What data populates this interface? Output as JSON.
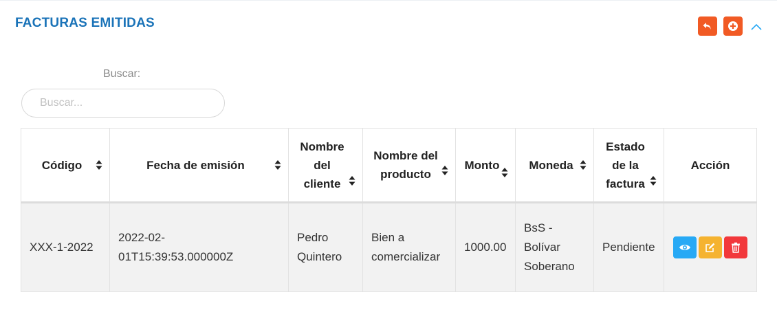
{
  "card": {
    "title": "FACTURAS EMITIDAS",
    "toolbar": [
      {
        "icon": "reply-icon",
        "color": "#f15a24"
      },
      {
        "icon": "plus-circle-icon",
        "color": "#f15a24"
      },
      {
        "icon": "chevron-up-icon",
        "color": "#27a9f5"
      }
    ]
  },
  "search": {
    "label": "Buscar:",
    "placeholder": "Buscar...",
    "value": ""
  },
  "table": {
    "columns": [
      {
        "label": "Código",
        "sortable": true
      },
      {
        "label": "Fecha de emisión",
        "sortable": true
      },
      {
        "label": "Nombre del cliente",
        "sortable": true
      },
      {
        "label": "Nombre del producto",
        "sortable": true
      },
      {
        "label": "Monto",
        "sortable": true
      },
      {
        "label": "Moneda",
        "sortable": true
      },
      {
        "label": "Estado de la factura",
        "sortable": true
      },
      {
        "label": "Acción",
        "sortable": false
      }
    ],
    "rows": [
      {
        "codigo": "XXX-1-2022",
        "fecha": "2022-02-01T15:39:53.000000Z",
        "cliente": "Pedro Quintero",
        "producto": "Bien a comercializar",
        "monto": "1000.00",
        "moneda": "BsS - Bolívar Soberano",
        "estado": "Pendiente",
        "actions": [
          {
            "icon": "eye-icon",
            "color": "#27a9f5"
          },
          {
            "icon": "edit-icon",
            "color": "#f5b330"
          },
          {
            "icon": "trash-icon",
            "color": "#f2383b"
          }
        ]
      }
    ]
  }
}
